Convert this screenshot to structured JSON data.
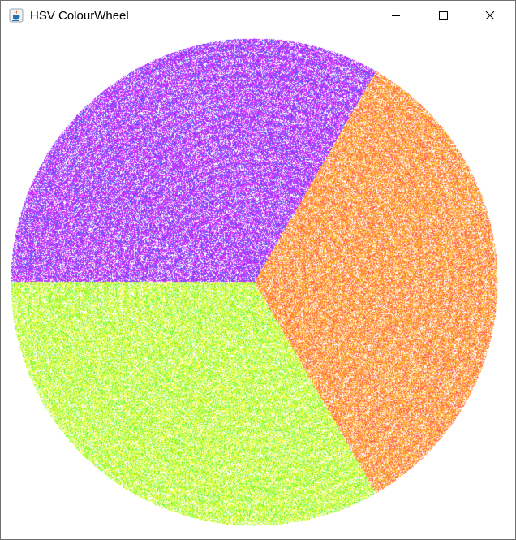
{
  "window": {
    "title": "HSV ColourWheel",
    "icon": "java-cup-icon",
    "controls": {
      "minimize_icon": "minimize-icon",
      "maximize_icon": "maximize-icon",
      "close_icon": "close-icon"
    }
  },
  "wheel": {
    "sectors": [
      {
        "name": "violet",
        "colors": [
          "#cc33ff",
          "#8844ff",
          "#ff44ff",
          "#5566ff",
          "#aa22ee"
        ]
      },
      {
        "name": "orange",
        "colors": [
          "#ff9933",
          "#ffcc44",
          "#ff5566",
          "#ffaa22",
          "#ff8844"
        ]
      },
      {
        "name": "yellow-green",
        "colors": [
          "#ccff33",
          "#66ff55",
          "#ffff44",
          "#99ee22",
          "#eeff66"
        ]
      }
    ]
  }
}
